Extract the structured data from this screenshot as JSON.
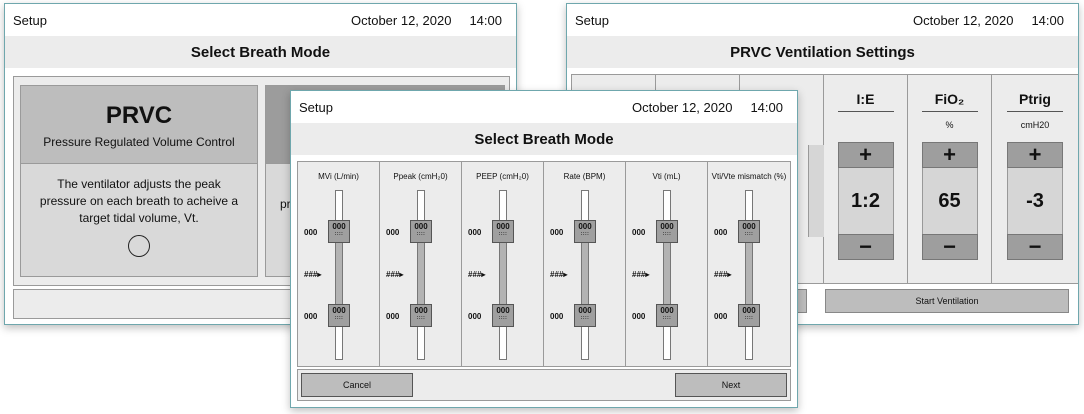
{
  "windows": [
    {
      "title": "Setup",
      "date": "October 12, 2020",
      "time": "14:00",
      "header": "Select Breath Mode",
      "cards": [
        {
          "name": "PRVC",
          "subtitle": "Pressure Regulated Volume Control",
          "description": "The ventilator adjusts the peak pressure on each breath to acheive a target tidal volume, Vt."
        },
        {
          "body_fragment": "pr"
        }
      ]
    },
    {
      "title": "Setup",
      "date": "October 12, 2020",
      "time": "14:00",
      "header": "PRVC Ventilation Settings",
      "settings": [
        {
          "label": "I:E",
          "unit": "",
          "value": "1:2"
        },
        {
          "label": "FiO₂",
          "unit": "%",
          "value": "65"
        },
        {
          "label": "Ptrig",
          "unit": "cmH20",
          "value": "-3"
        }
      ],
      "plus_label": "+",
      "minus_label": "−",
      "start_label": "Start Ventilation"
    },
    {
      "title": "Setup",
      "date": "October 12, 2020",
      "time": "14:00",
      "header": "Select Breath Mode",
      "sliders": [
        {
          "label": "MVi (L/min)"
        },
        {
          "label": "Ppeak (cmH₂0)"
        },
        {
          "label": "PEEP (cmH₂0)"
        },
        {
          "label": "Rate (BPM)"
        },
        {
          "label": "Vti (mL)"
        },
        {
          "label": "Vti/Vte mismatch (%)"
        }
      ],
      "slider_value": "000",
      "handle_value": "000",
      "handle_grip": "::::",
      "current_marker": "###",
      "cancel_label": "Cancel",
      "next_label": "Next"
    }
  ],
  "colors": {
    "window_border": "#6fa7ad",
    "header_bg": "#ececec",
    "card_head_bg": "#bdbdbd",
    "button_bg": "#9e9e9e"
  }
}
